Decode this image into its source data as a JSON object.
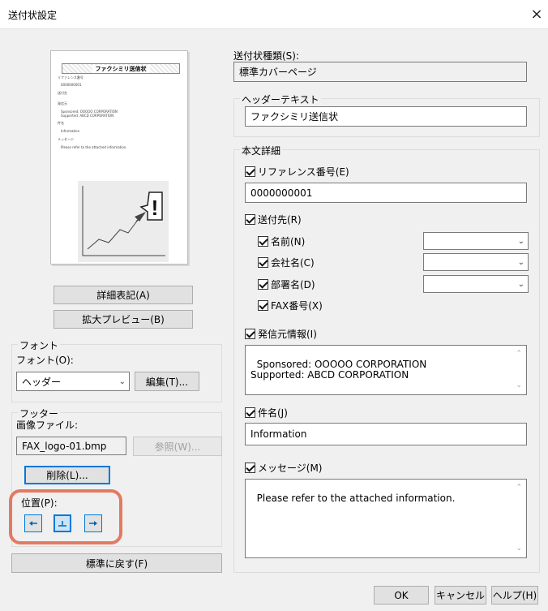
{
  "window": {
    "title": "送付状設定",
    "close_glyph": "×"
  },
  "preview": {
    "header": "ファクシミリ送信状",
    "lines": [
      "リファレンス番号",
      "0000000001",
      "送付先",
      "発信元",
      "Sponsored: OOOOO CORPORATION",
      "Supported: ABCD CORPORATION",
      "件名",
      "Information",
      "メッセージ",
      "Please refer to the attached information."
    ]
  },
  "buttons": {
    "details": "詳細表記(A)",
    "enlarge_preview": "拡大プレビュー(B)",
    "edit": "編集(T)...",
    "browse": "参照(W)...",
    "delete": "削除(L)...",
    "restore_default": "標準に戻す(F)",
    "ok": "OK",
    "cancel": "キャンセル",
    "help": "ヘルプ(H)"
  },
  "font_group": {
    "legend": "フォント",
    "font_label": "フォント(O):",
    "font_value": "ヘッダー"
  },
  "footer_group": {
    "legend": "フッター",
    "image_file_label": "画像ファイル:",
    "image_file_value": "FAX_logo-01.bmp",
    "position_label": "位置(P):"
  },
  "cover_type": {
    "label": "送付状種類(S):",
    "value": "標準カバーページ"
  },
  "header_text": {
    "legend": "ヘッダーテキスト",
    "value": "ファクシミリ送信状"
  },
  "body_details": {
    "legend": "本文詳細",
    "reference_label": "リファレンス番号(E)",
    "reference_value": "0000000001",
    "recipient_label": "送付先(R)",
    "name_label": "名前(N)",
    "company_label": "会社名(C)",
    "department_label": "部署名(D)",
    "fax_label": "FAX番号(X)",
    "sender_label": "発信元情報(I)",
    "sender_value": "Sponsored: OOOOO CORPORATION\nSupported: ABCD CORPORATION",
    "subject_label": "件名(J)",
    "subject_value": "Information",
    "message_label": "メッセージ(M)",
    "message_value": "Please refer to the attached information."
  }
}
